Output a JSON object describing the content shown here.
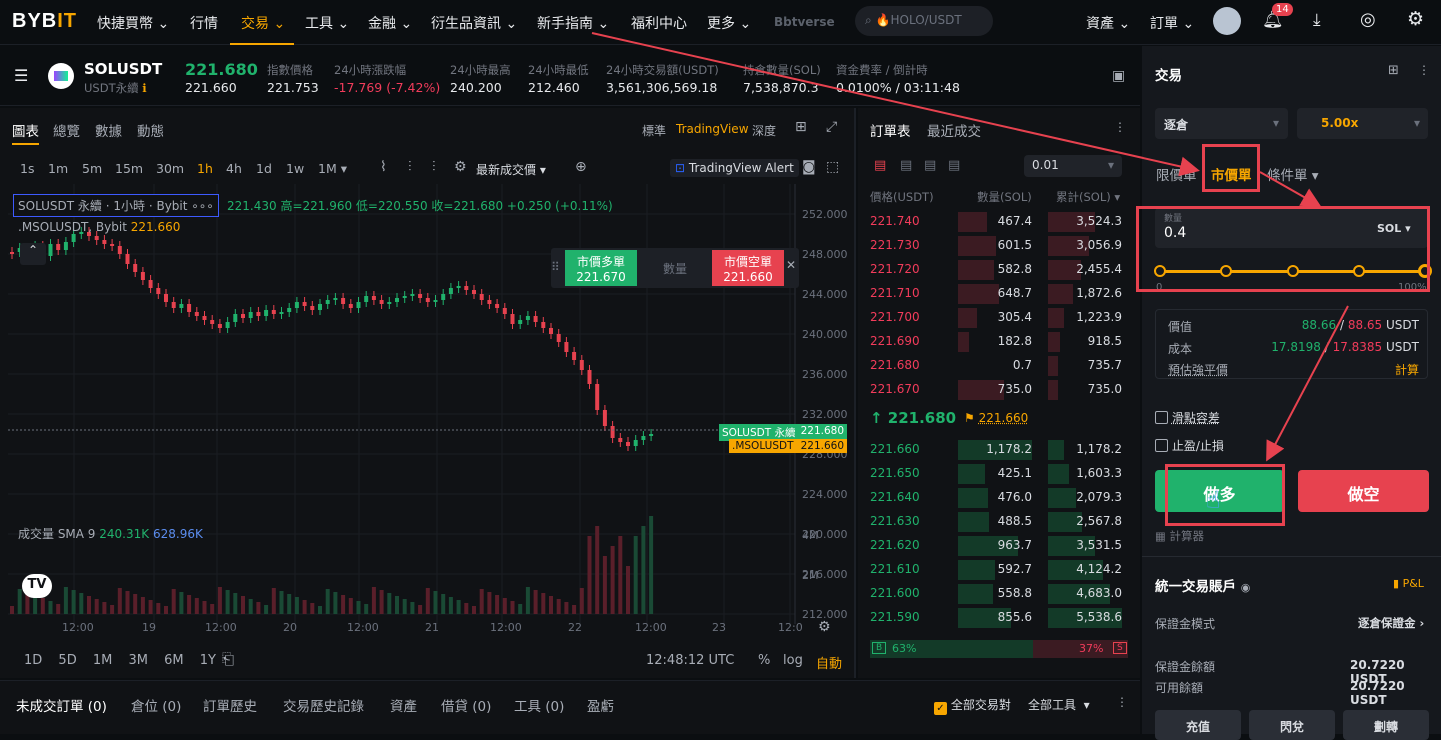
{
  "nav": {
    "logo": "BYB",
    "logo_accent": "IT",
    "items": [
      "快捷買幣",
      "行情",
      "交易",
      "工具",
      "金融",
      "衍生品資訊",
      "新手指南",
      "福利中心",
      "更多"
    ],
    "verse": "Bbtverse",
    "search": "🔥HOLO/USDT",
    "assets": "資產",
    "orders": "訂單",
    "notif_count": "14"
  },
  "symbol": {
    "name": "SOLUSDT",
    "sub": "USDT永續",
    "last": "221.680",
    "last_sub": "221.660",
    "stats": [
      {
        "label": "指數價格",
        "value": "221.753"
      },
      {
        "label": "24小時漲跌幅",
        "value": "-17.769 (-7.42%)"
      },
      {
        "label": "24小時最高",
        "value": "240.200"
      },
      {
        "label": "24小時最低",
        "value": "212.460"
      },
      {
        "label": "24小時交易額(USDT)",
        "value": "3,561,306,569.18"
      },
      {
        "label": "持倉數量(SOL)",
        "value": "7,538,870.3"
      },
      {
        "label": "資金費率 / 倒計時",
        "value": "0.0100% / 03:11:48"
      }
    ]
  },
  "chart": {
    "tabs": [
      "圖表",
      "總覽",
      "數據",
      "動態"
    ],
    "views": [
      "標準",
      "TradingView",
      "深度"
    ],
    "timeframes": [
      "1s",
      "1m",
      "5m",
      "15m",
      "30m",
      "1h",
      "4h",
      "1d",
      "1w",
      "1M"
    ],
    "active_tf": "1h",
    "price_type": "最新成交價",
    "alert": "TradingView Alert",
    "legend1": "SOLUSDT 永續 · 1小時 · Bybit",
    "ohlc": "221.430 高=221.960 低=220.550 收=221.680 +0.250 (+0.11%)",
    "legend2": ".MSOLUSDT, Bybit",
    "legend2_val": "221.660",
    "market_long": "市價多單",
    "market_long_val": "221.670",
    "qty": "數量",
    "market_short": "市價空單",
    "market_short_val": "221.660",
    "price_axis": [
      "252.000",
      "248.000",
      "244.000",
      "240.000",
      "236.000",
      "232.000",
      "228.000",
      "224.000",
      "220.000",
      "216.000",
      "212.000"
    ],
    "tag1": "SOLUSDT 永續",
    "tag1_val": "221.680",
    "tag2": ".MSOLUSDT",
    "tag2_val": "221.660",
    "vol_label": "成交量 SMA 9",
    "vol1": "240.31K",
    "vol2": "628.96K",
    "vol_axis": [
      "4M",
      "2M"
    ],
    "time_axis": [
      "12:00",
      "19",
      "12:00",
      "20",
      "12:00",
      "21",
      "12:00",
      "22",
      "12:00",
      "23",
      "12:0"
    ],
    "ranges": [
      "1D",
      "5D",
      "1M",
      "3M",
      "6M",
      "1Y"
    ],
    "clock": "12:48:12 UTC",
    "pct": "%",
    "log": "log",
    "auto": "自動"
  },
  "orderbook": {
    "tabs": [
      "訂單表",
      "最近成交"
    ],
    "step": "0.01",
    "headers": [
      "價格(USDT)",
      "數量(SOL)",
      "累計(SOL)"
    ],
    "asks": [
      [
        "221.740",
        "467.4",
        "3,524.3"
      ],
      [
        "221.730",
        "601.5",
        "3,056.9"
      ],
      [
        "221.720",
        "582.8",
        "2,455.4"
      ],
      [
        "221.710",
        "648.7",
        "1,872.6"
      ],
      [
        "221.700",
        "305.4",
        "1,223.9"
      ],
      [
        "221.690",
        "182.8",
        "918.5"
      ],
      [
        "221.680",
        "0.7",
        "735.7"
      ],
      [
        "221.670",
        "735.0",
        "735.0"
      ]
    ],
    "mid": "221.680",
    "mark": "221.660",
    "bids": [
      [
        "221.660",
        "1,178.2",
        "1,178.2"
      ],
      [
        "221.650",
        "425.1",
        "1,603.3"
      ],
      [
        "221.640",
        "476.0",
        "2,079.3"
      ],
      [
        "221.630",
        "488.5",
        "2,567.8"
      ],
      [
        "221.620",
        "963.7",
        "3,531.5"
      ],
      [
        "221.610",
        "592.7",
        "4,124.2"
      ],
      [
        "221.600",
        "558.8",
        "4,683.0"
      ],
      [
        "221.590",
        "855.6",
        "5,538.6"
      ]
    ],
    "buy_pct": "63%",
    "sell_pct": "37%",
    "b": "B",
    "s": "S"
  },
  "panel": {
    "title": "交易",
    "margin_mode": "逐倉",
    "leverage": "5.00x",
    "order_tabs": [
      "限價單",
      "市價單",
      "條件單"
    ],
    "qty_label": "數量",
    "qty": "0.4",
    "unit": "SOL",
    "slider_min": "0",
    "slider_max": "100%",
    "price_label": "價值",
    "price_g": "88.66",
    "price_r": "88.65",
    "price_u": "USDT",
    "cost_label": "成本",
    "cost_g": "17.8198",
    "cost_r": "17.8385",
    "cost_u": "USDT",
    "liq_label": "預估強平價",
    "liq_val": "計算",
    "slip": "滑點容差",
    "tpsl": "止盈/止損",
    "long": "做多",
    "short": "做空",
    "calc": "計算器",
    "account": "統一交易賬戶",
    "pnl": "P&L",
    "margin_label": "保證金模式",
    "margin_val": "逐倉保證金",
    "bal_label": "保證金餘額",
    "bal_val": "20.7220 USDT",
    "avail_label": "可用餘額",
    "avail_val": "20.7220 USDT",
    "btns": [
      "充值",
      "閃兌",
      "劃轉"
    ]
  },
  "bottom": {
    "tabs": [
      "未成交訂單 (0)",
      "倉位 (0)",
      "訂單歷史",
      "交易歷史記錄",
      "資產",
      "借貸 (0)",
      "工具 (0)",
      "盈虧"
    ],
    "all_pairs": "全部交易對",
    "all_tools": "全部工具"
  }
}
